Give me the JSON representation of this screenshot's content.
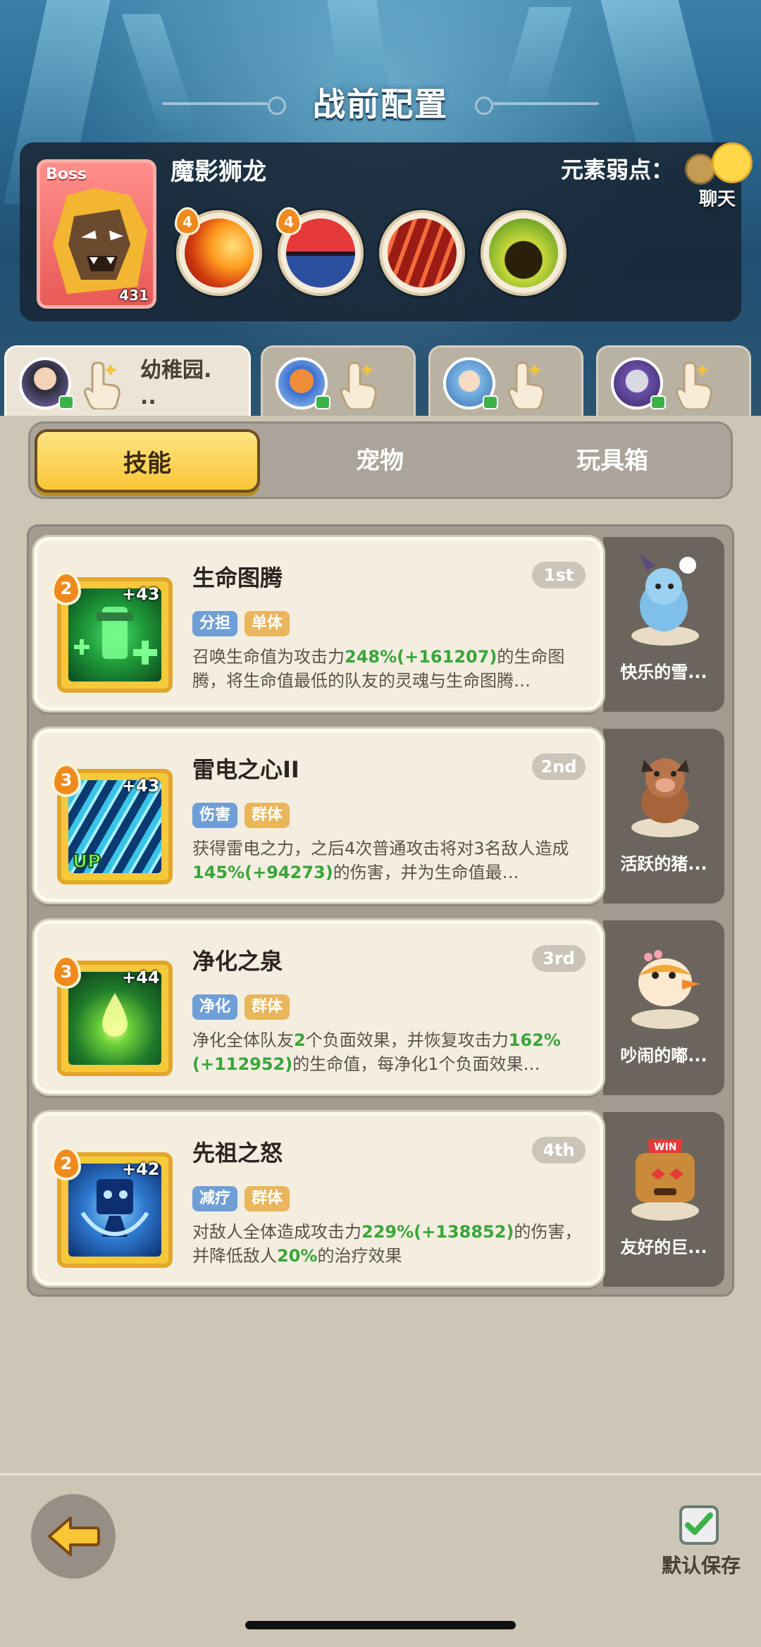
{
  "header": {
    "title": "战前配置"
  },
  "boss": {
    "tag": "Boss",
    "level": "431",
    "name": "魔影狮龙",
    "weakness_label": "元素弱点：",
    "skills": [
      {
        "icon": "fire-swoosh-icon",
        "badge": "4"
      },
      {
        "icon": "pokeball-bird-icon",
        "badge": "4"
      },
      {
        "icon": "claw-slash-icon",
        "badge": ""
      },
      {
        "icon": "dark-creature-icon",
        "badge": ""
      }
    ]
  },
  "chat": {
    "label": "聊天"
  },
  "heroes": [
    {
      "name": "幼稚园.\n..",
      "avatar": "hero-girl-avatar",
      "active": true
    },
    {
      "name": "",
      "avatar": "hero-fox-avatar",
      "active": false
    },
    {
      "name": "",
      "avatar": "hero-elf-avatar",
      "active": false
    },
    {
      "name": "",
      "avatar": "hero-masked-avatar",
      "active": false
    }
  ],
  "tabs": {
    "skill": "技能",
    "pet": "宠物",
    "toybox": "玩具箱"
  },
  "skills": [
    {
      "level": "2",
      "bonus": "+43",
      "name": "生命图腾",
      "rank": "1st",
      "tags": [
        "分担",
        "单体"
      ],
      "desc_a": "召唤生命值为攻击力",
      "desc_hl1": "248%(+161207)",
      "desc_b": "的生命图腾，将生命值最低的队友的灵魂与生命图腾…",
      "pet_name": "快乐的雪...",
      "art": "totem-icon"
    },
    {
      "level": "3",
      "bonus": "+43",
      "name": "雷电之心II",
      "rank": "2nd",
      "tags": [
        "伤害",
        "群体"
      ],
      "desc_a": "获得雷电之力，之后4次普通攻击将对3名敌人造成",
      "desc_hl1": "145%(+94273)",
      "desc_b": "的伤害，并为生命值最…",
      "pet_name": "活跃的猪...",
      "art": "lightning-icon"
    },
    {
      "level": "3",
      "bonus": "+44",
      "name": "净化之泉",
      "rank": "3rd",
      "tags": [
        "净化",
        "群体"
      ],
      "desc_a": "净化全体队友",
      "desc_hl1": "2",
      "desc_b": "个负面效果，并恢复攻击力",
      "desc_hl2": "162%(+112952)",
      "desc_c": "的生命值，每净化1个负面效果…",
      "pet_name": "吵闹的嘟...",
      "art": "spring-drop-icon"
    },
    {
      "level": "2",
      "bonus": "+42",
      "name": "先祖之怒",
      "rank": "4th",
      "tags": [
        "减疗",
        "群体"
      ],
      "desc_a": "对敌人全体造成攻击力",
      "desc_hl1": "229%(+138852)",
      "desc_b": "的伤害，并降低敌人",
      "desc_hl2": "20%",
      "desc_c": "的治疗效果",
      "pet_name": "友好的巨...",
      "art": "ancestor-spirit-icon"
    }
  ],
  "bottom": {
    "save_label": "默认保存"
  },
  "colors": {
    "gold": "#f9c636",
    "highlight": "#3aa53a",
    "boss_card": "#e85a57"
  }
}
